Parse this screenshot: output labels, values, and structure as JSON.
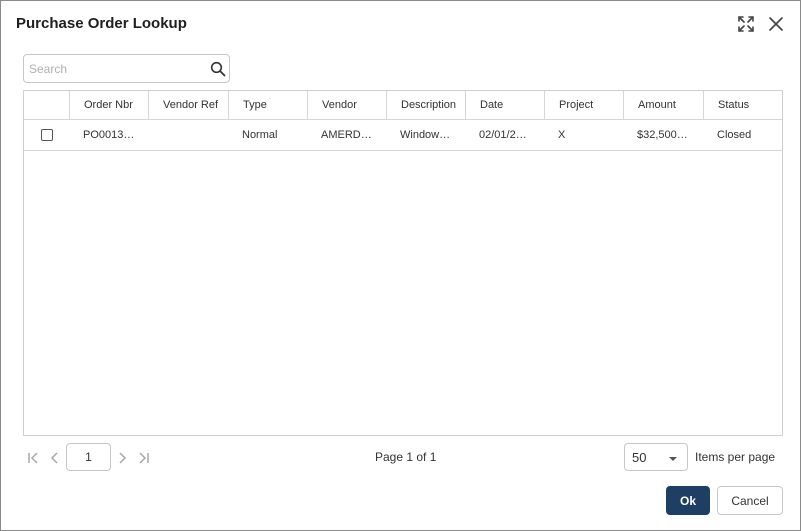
{
  "dialog": {
    "title": "Purchase Order Lookup",
    "icons": {
      "expand": "expand-icon",
      "close": "close-icon"
    }
  },
  "search": {
    "placeholder": "Search",
    "value": "",
    "icon": "search-icon"
  },
  "grid": {
    "columns": [
      "",
      "Order Nbr",
      "Vendor Ref",
      "Type",
      "Vendor",
      "Description",
      "Date",
      "Project",
      "Amount",
      "Status"
    ],
    "rows": [
      {
        "checked": false,
        "order_nbr": "PO0013…",
        "vendor_ref": "",
        "type": "Normal",
        "vendor": "AMERD…",
        "description": "Window…",
        "date": "02/01/2…",
        "project": "X",
        "amount": "$32,500…",
        "status": "Closed"
      }
    ]
  },
  "pager": {
    "current_page": "1",
    "page_info": "Page 1 of 1",
    "items_per_page": "50",
    "items_per_page_label": "Items per page",
    "icons": {
      "first": "first-page-icon",
      "prev": "prev-page-icon",
      "next": "next-page-icon",
      "last": "last-page-icon"
    }
  },
  "footer": {
    "ok_label": "Ok",
    "cancel_label": "Cancel"
  },
  "colors": {
    "primary": "#1e3f63",
    "border": "#cfcfcf"
  }
}
